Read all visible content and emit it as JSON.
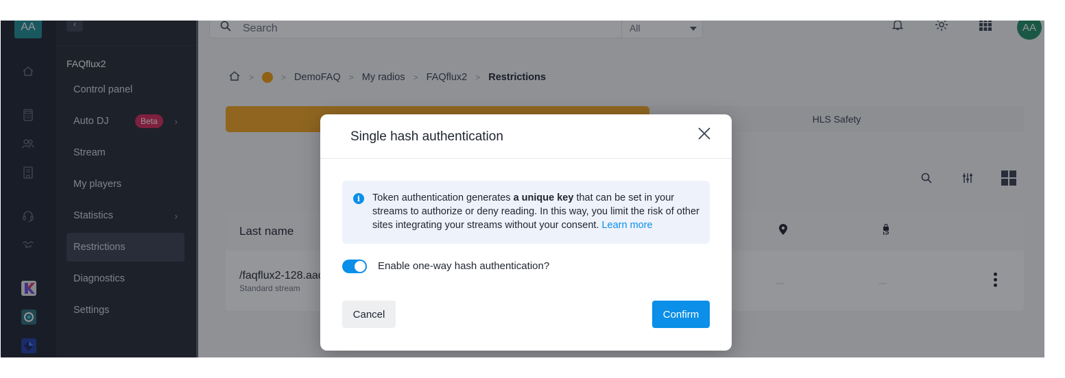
{
  "rail": {
    "avatar": "AA"
  },
  "sidebar": {
    "collapse_glyph": "‹",
    "title": "FAQflux2",
    "items": [
      {
        "label": "Control panel"
      },
      {
        "label": "Auto DJ",
        "badge": "Beta"
      },
      {
        "label": "Stream"
      },
      {
        "label": "My players"
      },
      {
        "label": "Statistics"
      },
      {
        "label": "Restrictions",
        "active": true
      },
      {
        "label": "Diagnostics"
      },
      {
        "label": "Settings"
      }
    ],
    "chevron": "›"
  },
  "header": {
    "search_placeholder": "Search",
    "filter_value": "All",
    "user_avatar": "AA"
  },
  "breadcrumb": {
    "separator": ">",
    "items": [
      "DemoFAQ",
      "My radios",
      "FAQflux2"
    ],
    "current": "Restrictions"
  },
  "tabs": {
    "hls": "HLS Safety"
  },
  "table": {
    "header_last_name": "Last name",
    "row_name": "/faqflux2-128.aac",
    "row_type": "Standard stream",
    "dash": "—"
  },
  "modal": {
    "title": "Single hash authentication",
    "info_pre": "Token authentication generates ",
    "info_bold": "a unique key",
    "info_post": " that can be set in your streams to authorize or deny reading. In this way, you limit the risk of other sites integrating your streams without your consent. ",
    "info_link": "Learn more",
    "info_icon_glyph": "i",
    "toggle_label": "Enable one-way hash authentication?",
    "toggle_on": true,
    "cancel": "Cancel",
    "confirm": "Confirm"
  },
  "icons": {
    "rail": [
      "home-icon",
      "calculator-icon",
      "users-icon",
      "building-icon",
      "headset-icon",
      "handshake-icon"
    ],
    "apps": [
      "kchat-app-icon",
      "kmeet-app-icon",
      "kdrive-app-icon"
    ],
    "top": [
      "bell-icon",
      "gear-icon",
      "grid-icon"
    ],
    "tools": [
      "search-icon",
      "filter-sliders-icon",
      "grid-view-icon"
    ],
    "table": [
      "location-pin-icon",
      "lock-ip-icon"
    ]
  },
  "colors": {
    "accent_blue": "#0b8fe8",
    "tab_orange": "#f5a623",
    "beta_badge": "#d6295a",
    "sidebar_bg": "#252b36"
  }
}
